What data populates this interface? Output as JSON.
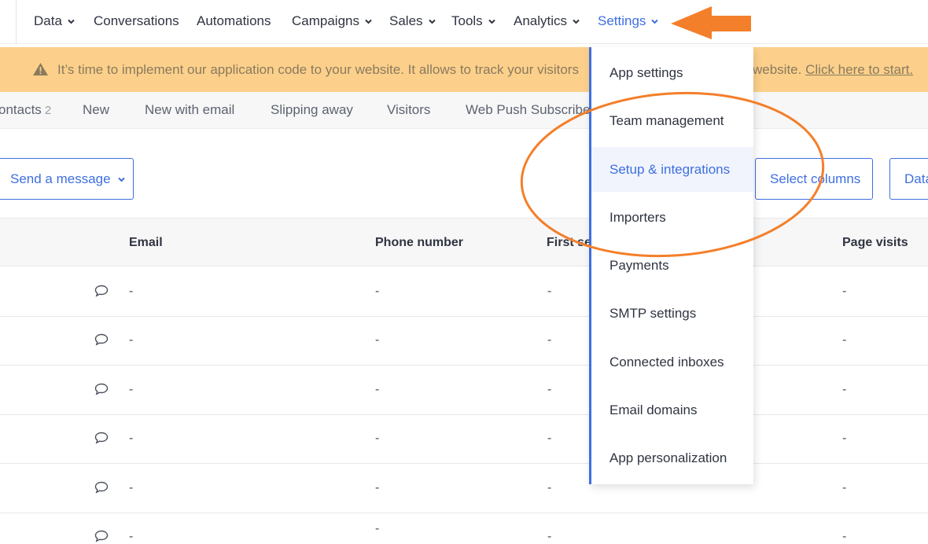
{
  "nav": {
    "items": [
      {
        "label": "Data",
        "chevron": true,
        "active": false
      },
      {
        "label": "Conversations",
        "chevron": false,
        "active": false
      },
      {
        "label": "Automations",
        "chevron": false,
        "active": false
      },
      {
        "label": "Campaigns",
        "chevron": true,
        "active": false
      },
      {
        "label": "Sales",
        "chevron": true,
        "active": false
      },
      {
        "label": "Tools",
        "chevron": true,
        "active": false
      },
      {
        "label": "Analytics",
        "chevron": true,
        "active": false
      },
      {
        "label": "Settings",
        "chevron": true,
        "active": true
      }
    ]
  },
  "banner": {
    "text_left": "It’s time to implement our application code to your website. It allows to track your visitors",
    "text_right": "website.",
    "link": "Click here to start."
  },
  "segments": [
    {
      "label": "ontacts",
      "count": "2"
    },
    {
      "label": "New",
      "count": ""
    },
    {
      "label": "New with email",
      "count": ""
    },
    {
      "label": "Slipping away",
      "count": ""
    },
    {
      "label": "Visitors",
      "count": ""
    },
    {
      "label": "Web Push Subscriber",
      "count": ""
    }
  ],
  "toolbar": {
    "send_label": "Send a message",
    "columns_label": "Select columns",
    "data_label": "Data"
  },
  "table": {
    "headers": [
      "Email",
      "Phone number",
      "First se",
      "Page visits"
    ],
    "rows": [
      {
        "email": "-",
        "phone": "-",
        "first": "-",
        "visits": "-"
      },
      {
        "email": "-",
        "phone": "-",
        "first": "-",
        "visits": "-"
      },
      {
        "email": "-",
        "phone": "-",
        "first": "-",
        "visits": "-"
      },
      {
        "email": "-",
        "phone": "-",
        "first": "-",
        "visits": "-"
      },
      {
        "email": "-",
        "phone": "-",
        "first": "-",
        "visits": "-"
      },
      {
        "email": "-",
        "phone": "-",
        "first": "-",
        "visits": "-"
      }
    ]
  },
  "settings_menu": {
    "items": [
      {
        "label": "App settings",
        "highlighted": false
      },
      {
        "label": "Team management",
        "highlighted": false
      },
      {
        "label": "Setup & integrations",
        "highlighted": true
      },
      {
        "label": "Importers",
        "highlighted": false
      },
      {
        "label": "Payments",
        "highlighted": false
      },
      {
        "label": "SMTP settings",
        "highlighted": false
      },
      {
        "label": "Connected inboxes",
        "highlighted": false
      },
      {
        "label": "Email domains",
        "highlighted": false
      },
      {
        "label": "App personalization",
        "highlighted": false
      }
    ]
  },
  "colors": {
    "accent": "#3e6fe0",
    "banner": "#fcd08b",
    "annotation": "#f47f2a"
  }
}
